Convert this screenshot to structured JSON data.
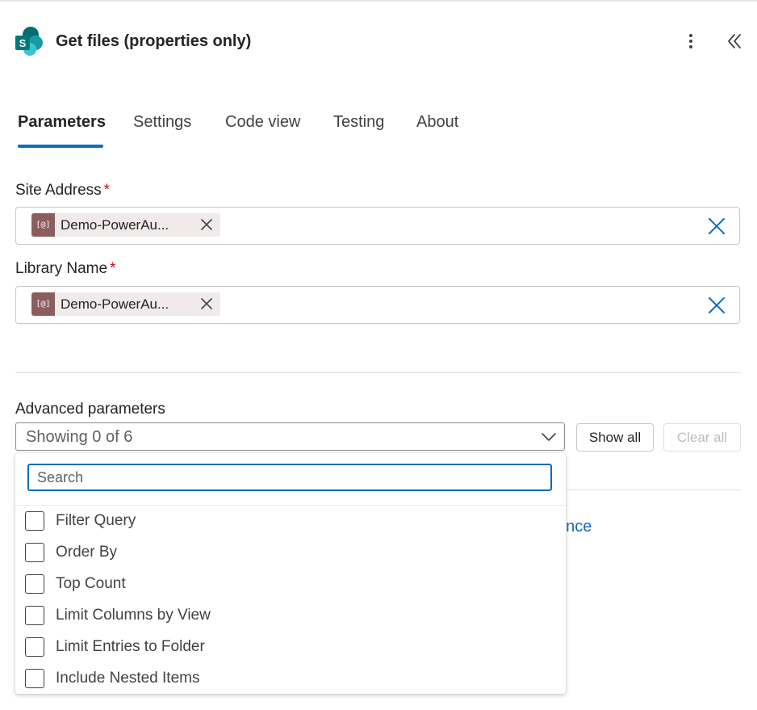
{
  "header": {
    "title": "Get files (properties only)",
    "icon": "sharepoint-icon",
    "more_icon": "more-vertical-icon",
    "collapse_icon": "double-chevron-left-icon"
  },
  "tabs": [
    {
      "label": "Parameters",
      "active": true
    },
    {
      "label": "Settings",
      "active": false
    },
    {
      "label": "Code view",
      "active": false
    },
    {
      "label": "Testing",
      "active": false
    },
    {
      "label": "About",
      "active": false
    }
  ],
  "fields": {
    "site_address": {
      "label": "Site Address",
      "required_mark": "*",
      "token_text": "Demo-PowerAu...",
      "token_icon_text": "[@]"
    },
    "library_name": {
      "label": "Library Name",
      "required_mark": "*",
      "token_text": "Demo-PowerAu...",
      "token_icon_text": "[@]"
    }
  },
  "advanced": {
    "label": "Advanced parameters",
    "select_value": "Showing 0 of 6",
    "show_all_label": "Show all",
    "clear_all_label": "Clear all",
    "partial_link_text": "ence"
  },
  "dropdown": {
    "search_placeholder": "Search",
    "options": [
      {
        "label": "Filter Query",
        "checked": false
      },
      {
        "label": "Order By",
        "checked": false
      },
      {
        "label": "Top Count",
        "checked": false
      },
      {
        "label": "Limit Columns by View",
        "checked": false
      },
      {
        "label": "Limit Entries to Folder",
        "checked": false
      },
      {
        "label": "Include Nested Items",
        "checked": false
      }
    ]
  },
  "colors": {
    "accent": "#0f6cbd",
    "required": "#c50f1f",
    "token_icon_bg": "#8b5e5e",
    "token_bg": "#f0eaea"
  }
}
